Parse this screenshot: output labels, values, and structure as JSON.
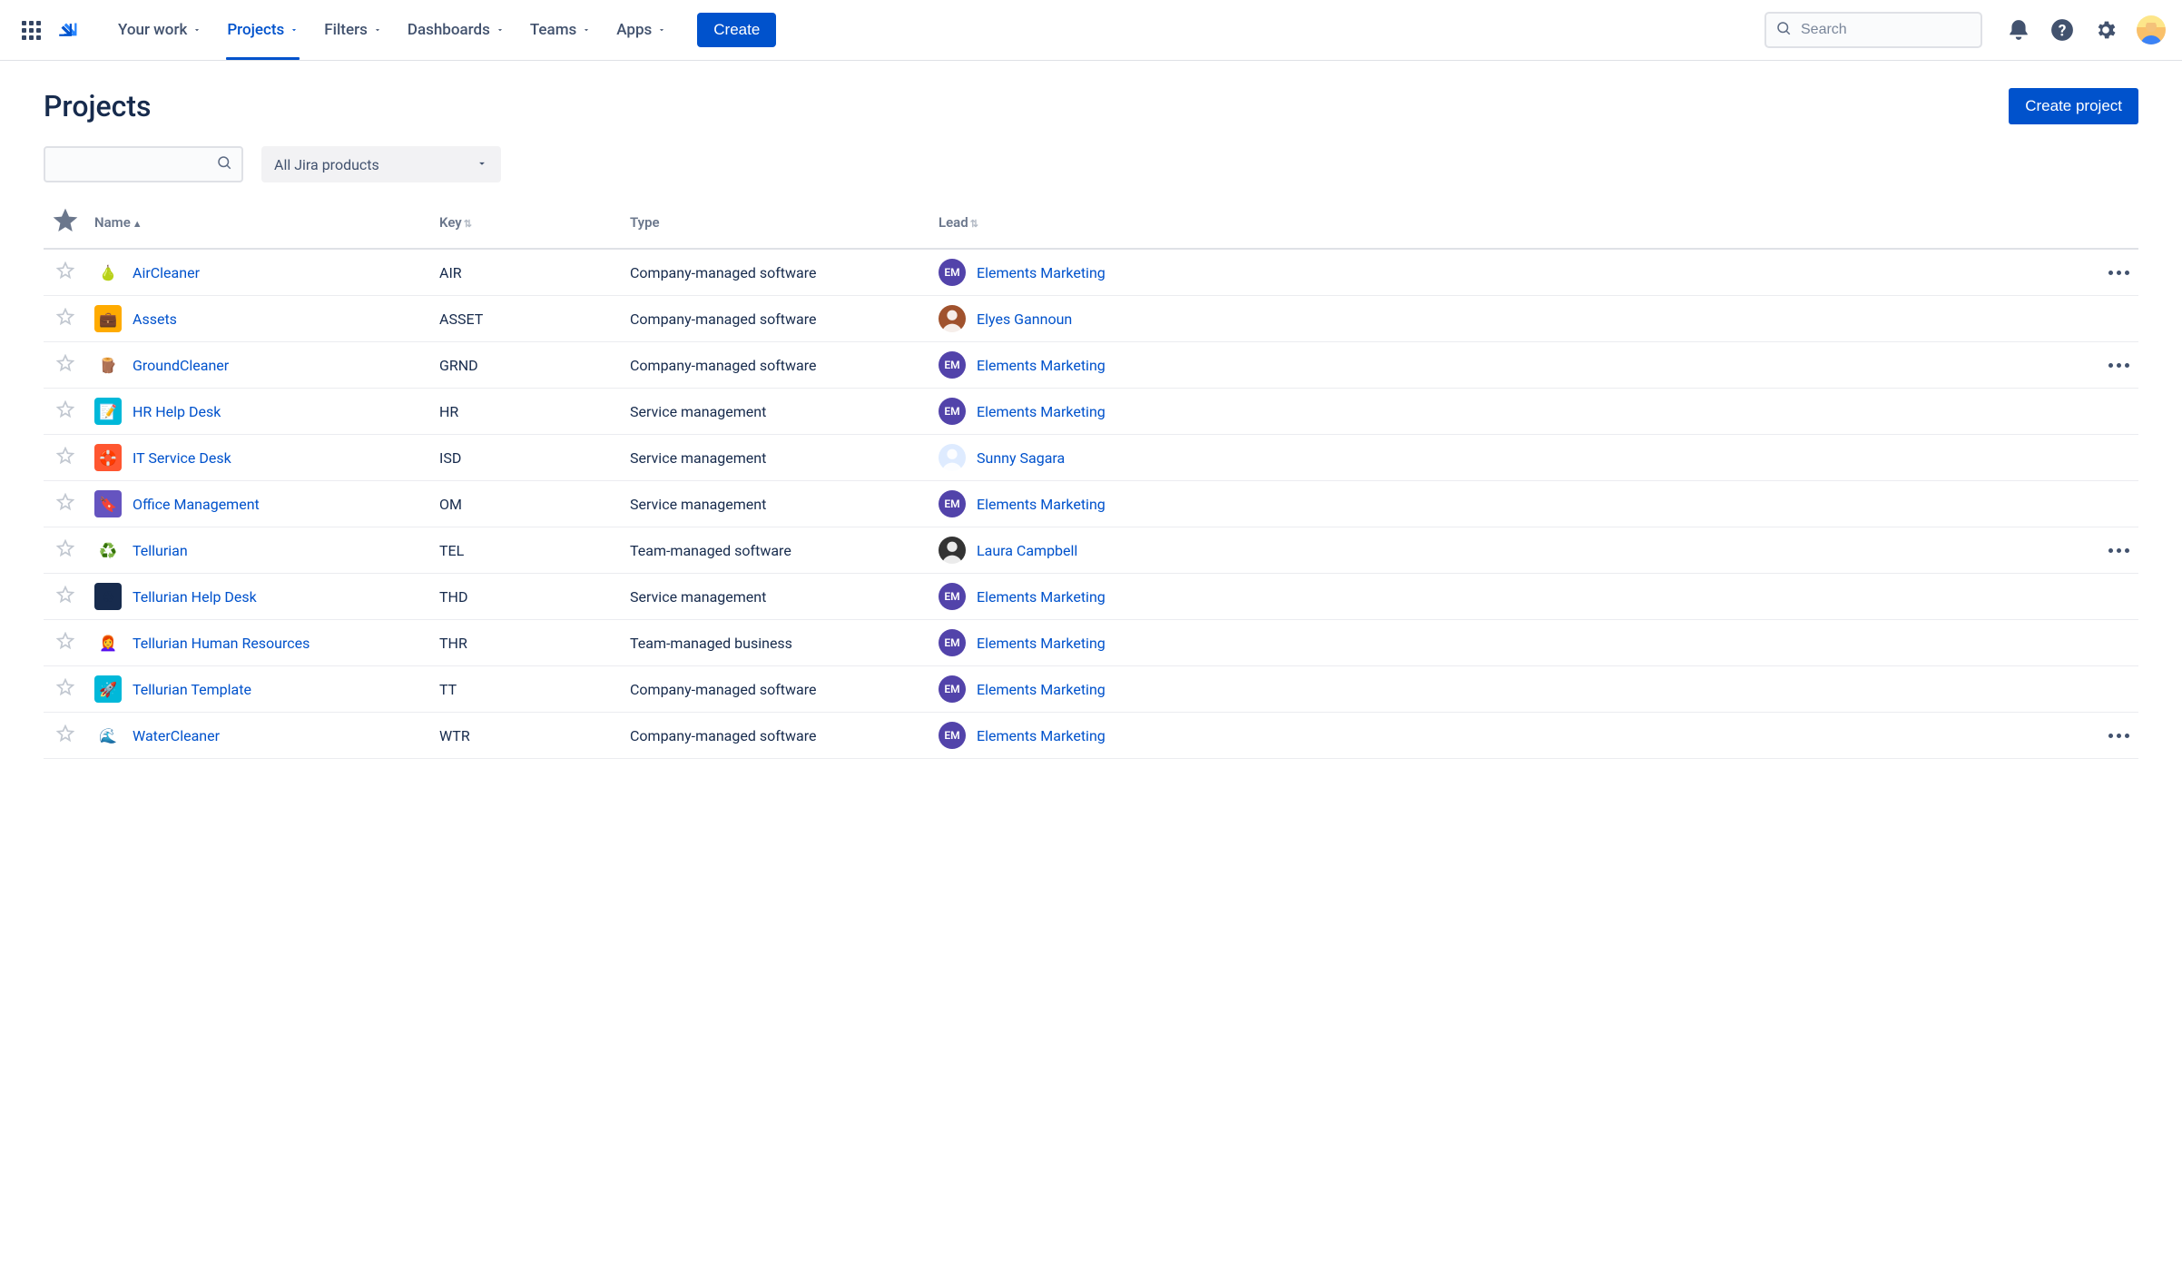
{
  "nav": {
    "items": [
      {
        "label": "Your work",
        "active": false
      },
      {
        "label": "Projects",
        "active": true
      },
      {
        "label": "Filters",
        "active": false
      },
      {
        "label": "Dashboards",
        "active": false
      },
      {
        "label": "Teams",
        "active": false
      },
      {
        "label": "Apps",
        "active": false
      }
    ],
    "create_label": "Create",
    "search_placeholder": "Search"
  },
  "page": {
    "title": "Projects",
    "create_project_label": "Create project",
    "product_filter": "All Jira products"
  },
  "table": {
    "headers": {
      "name": "Name",
      "key": "Key",
      "type": "Type",
      "lead": "Lead"
    },
    "rows": [
      {
        "name": "AirCleaner",
        "key": "AIR",
        "type": "Company-managed software",
        "lead_name": "Elements Marketing",
        "lead_initials": "EM",
        "lead_bg": "#5243AA",
        "more": true,
        "icon_bg": "#fff",
        "icon_emoji": "🍐"
      },
      {
        "name": "Assets",
        "key": "ASSET",
        "type": "Company-managed software",
        "lead_name": "Elyes Gannoun",
        "lead_initials": "",
        "lead_bg": "#A0522D",
        "more": false,
        "icon_bg": "#FFAB00",
        "icon_emoji": "💼"
      },
      {
        "name": "GroundCleaner",
        "key": "GRND",
        "type": "Company-managed software",
        "lead_name": "Elements Marketing",
        "lead_initials": "EM",
        "lead_bg": "#5243AA",
        "more": true,
        "icon_bg": "#fff",
        "icon_emoji": "🪵"
      },
      {
        "name": "HR Help Desk",
        "key": "HR",
        "type": "Service management",
        "lead_name": "Elements Marketing",
        "lead_initials": "EM",
        "lead_bg": "#5243AA",
        "more": false,
        "icon_bg": "#00B8D9",
        "icon_emoji": "📝"
      },
      {
        "name": "IT Service Desk",
        "key": "ISD",
        "type": "Service management",
        "lead_name": "Sunny Sagara",
        "lead_initials": "",
        "lead_bg": "#DEEBFF",
        "more": false,
        "icon_bg": "#FF5630",
        "icon_emoji": "🛟"
      },
      {
        "name": "Office Management",
        "key": "OM",
        "type": "Service management",
        "lead_name": "Elements Marketing",
        "lead_initials": "EM",
        "lead_bg": "#5243AA",
        "more": false,
        "icon_bg": "#6554C0",
        "icon_emoji": "🔖"
      },
      {
        "name": "Tellurian",
        "key": "TEL",
        "type": "Team-managed software",
        "lead_name": "Laura Campbell",
        "lead_initials": "",
        "lead_bg": "#333",
        "more": true,
        "icon_bg": "#fff",
        "icon_emoji": "♻️"
      },
      {
        "name": "Tellurian Help Desk",
        "key": "THD",
        "type": "Service management",
        "lead_name": "Elements Marketing",
        "lead_initials": "EM",
        "lead_bg": "#5243AA",
        "more": false,
        "icon_bg": "#172B4D",
        "icon_emoji": "♻"
      },
      {
        "name": "Tellurian Human Resources",
        "key": "THR",
        "type": "Team-managed business",
        "lead_name": "Elements Marketing",
        "lead_initials": "EM",
        "lead_bg": "#5243AA",
        "more": false,
        "icon_bg": "#fff",
        "icon_emoji": "👩‍🦰"
      },
      {
        "name": "Tellurian Template",
        "key": "TT",
        "type": "Company-managed software",
        "lead_name": "Elements Marketing",
        "lead_initials": "EM",
        "lead_bg": "#5243AA",
        "more": false,
        "icon_bg": "#00B8D9",
        "icon_emoji": "🚀"
      },
      {
        "name": "WaterCleaner",
        "key": "WTR",
        "type": "Company-managed software",
        "lead_name": "Elements Marketing",
        "lead_initials": "EM",
        "lead_bg": "#5243AA",
        "more": true,
        "icon_bg": "#fff",
        "icon_emoji": "🌊"
      }
    ]
  }
}
